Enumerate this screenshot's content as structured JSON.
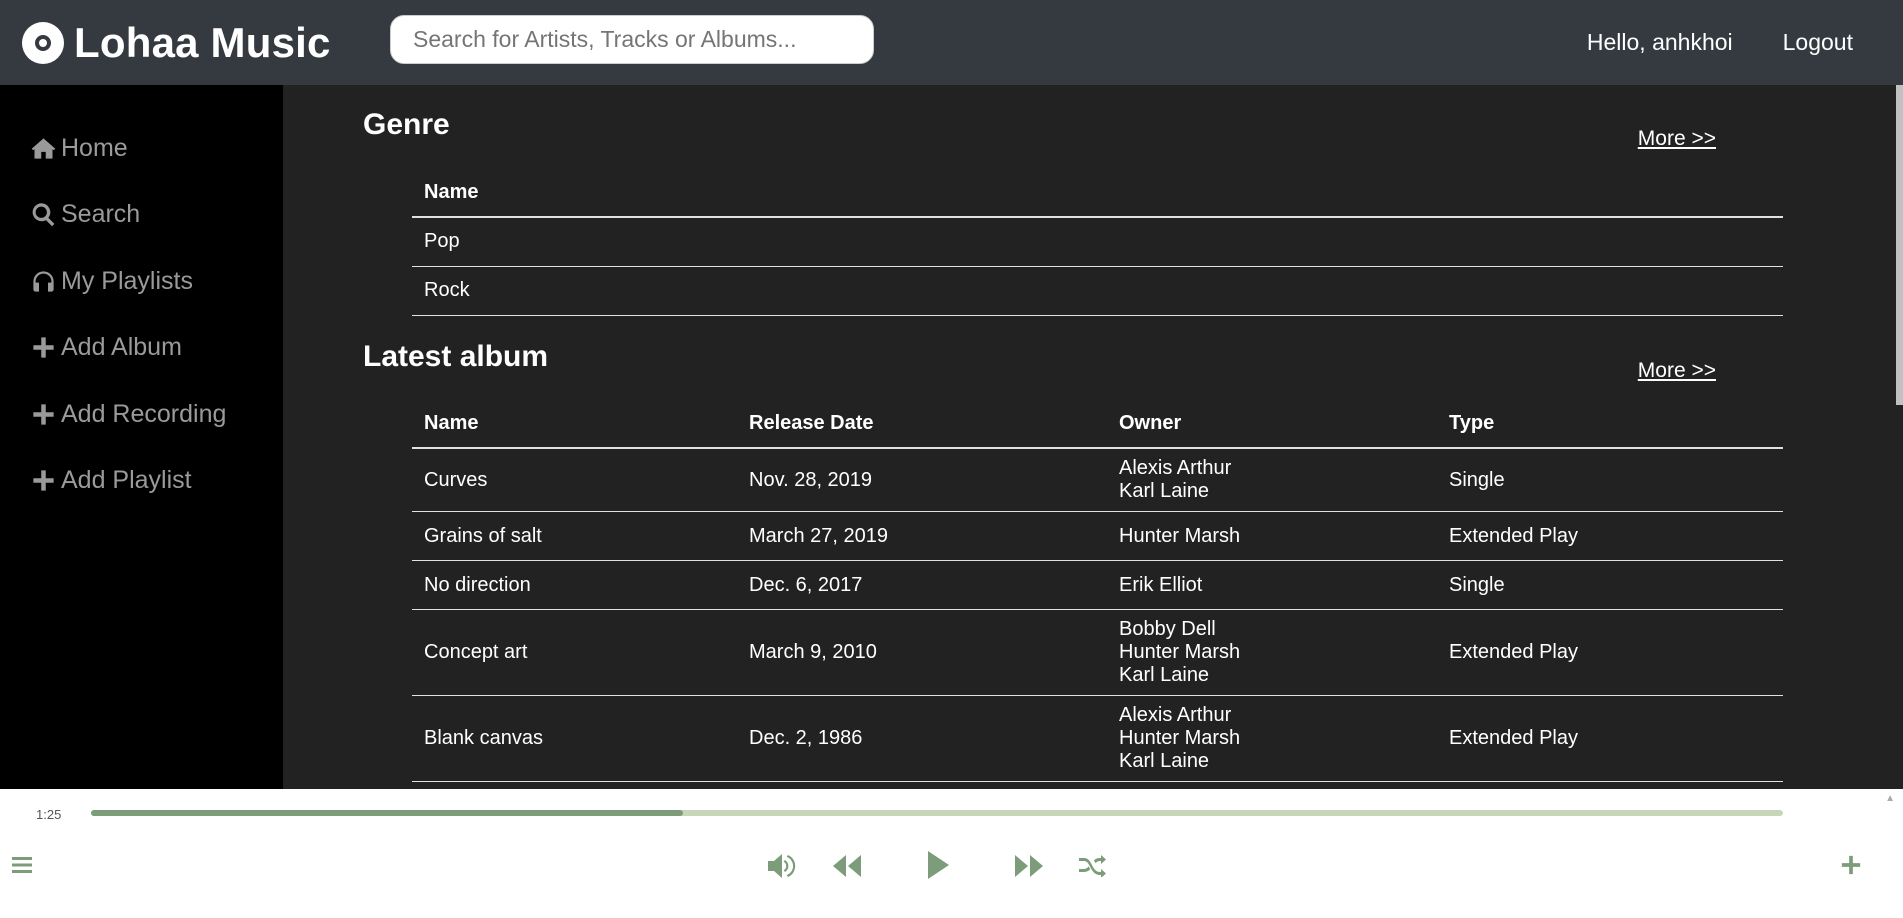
{
  "brand": {
    "name": "Lohaa Music"
  },
  "search": {
    "placeholder": "Search for Artists, Tracks or Albums..."
  },
  "user": {
    "greeting": "Hello, anhkhoi",
    "logout": "Logout"
  },
  "sidebar": {
    "items": [
      {
        "label": "Home",
        "icon": "home-icon"
      },
      {
        "label": "Search",
        "icon": "search-icon"
      },
      {
        "label": "My Playlists",
        "icon": "headphones-icon"
      },
      {
        "label": "Add Album",
        "icon": "plus-icon"
      },
      {
        "label": "Add Recording",
        "icon": "plus-icon"
      },
      {
        "label": "Add Playlist",
        "icon": "plus-icon"
      }
    ]
  },
  "genre": {
    "title": "Genre",
    "more": "More >>",
    "header": "Name",
    "rows": [
      "Pop",
      "Rock"
    ]
  },
  "albums": {
    "title": "Latest album",
    "more": "More >>",
    "headers": [
      "Name",
      "Release Date",
      "Owner",
      "Type"
    ],
    "rows": [
      {
        "name": "Curves",
        "date": "Nov. 28, 2019",
        "owners": [
          "Alexis Arthur",
          "Karl Laine"
        ],
        "type": "Single"
      },
      {
        "name": "Grains of salt",
        "date": "March 27, 2019",
        "owners": [
          "Hunter Marsh"
        ],
        "type": "Extended Play"
      },
      {
        "name": "No direction",
        "date": "Dec. 6, 2017",
        "owners": [
          "Erik Elliot"
        ],
        "type": "Single"
      },
      {
        "name": "Concept art",
        "date": "March 9, 2010",
        "owners": [
          "Bobby Dell",
          "Hunter Marsh",
          "Karl Laine"
        ],
        "type": "Extended Play"
      },
      {
        "name": "Blank canvas",
        "date": "Dec. 2, 1986",
        "owners": [
          "Alexis Arthur",
          "Hunter Marsh",
          "Karl Laine"
        ],
        "type": "Extended Play"
      }
    ]
  },
  "player": {
    "time": "1:25",
    "progress_fraction": 0.35,
    "accent": "#7d9c7a",
    "track_color": "#c7d6b8"
  }
}
